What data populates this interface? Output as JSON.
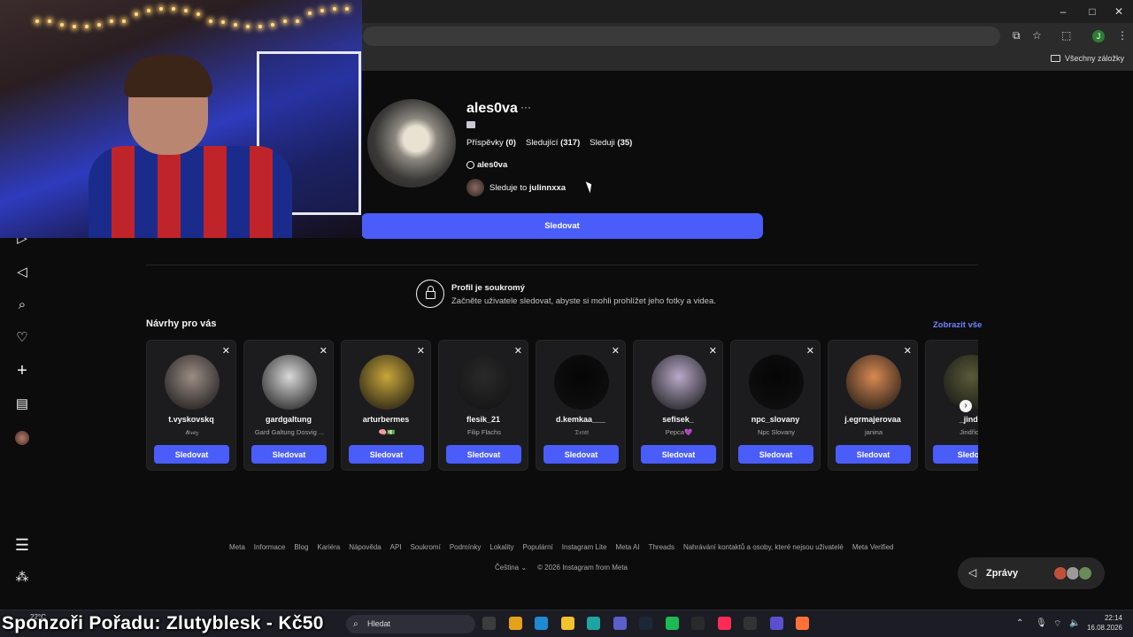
{
  "browser": {
    "window_controls": [
      "–",
      "□",
      "✕"
    ],
    "bookmarks_all_label": "Všechny záložky",
    "account_initial": "J"
  },
  "sidebar": {
    "icons": [
      "reels-icon",
      "send-icon",
      "search-icon",
      "heart-icon",
      "plus-icon",
      "insights-icon"
    ],
    "bottom_icons": [
      "menu-icon",
      "apps-icon"
    ]
  },
  "profile": {
    "username": "ales0va",
    "more_label": "···",
    "stats": {
      "posts_label": "Příspěvky",
      "posts_value": "(0)",
      "followers_label": "Sledující",
      "followers_value": "(317)",
      "following_label": "Sleduji",
      "following_value": "(35)"
    },
    "threads_handle": "ales0va",
    "followed_by_prefix": "Sleduje to",
    "followed_by_user": "julinnxxa",
    "follow_button": "Sledovat"
  },
  "private_notice": {
    "title": "Profil je soukromý",
    "description": "Začněte uživatele sledovat, abyste si mohli prohlížet jeho fotky a videa."
  },
  "suggestions": {
    "title": "Návrhy pro vás",
    "see_all": "Zobrazit vše",
    "items": [
      {
        "name": "t.vyskovskq",
        "sub": "𝓉𝑒𝓇𝑒𝓏",
        "button": "Sledovat",
        "color": "#9c8d85"
      },
      {
        "name": "gardgaltung",
        "sub": "Gard Galtung Dosvig ...",
        "button": "Sledovat",
        "color": "#d9d9d9"
      },
      {
        "name": "arturbermes",
        "sub": "🧠💵",
        "button": "Sledovat",
        "color": "#c9a63a"
      },
      {
        "name": "flesik_21",
        "sub": "Filip Flachs",
        "button": "Sledovat",
        "color": "#2a2a2a"
      },
      {
        "name": "d.kemkaa___",
        "sub": "𝔇𝔢𝔪𝔦",
        "button": "Sledovat",
        "color": "#050505"
      },
      {
        "name": "sefisek_",
        "sub": "Pepca💜",
        "button": "Sledovat",
        "color": "#b8a9c9"
      },
      {
        "name": "npc_slovany",
        "sub": "Npc Slovany",
        "button": "Sledovat",
        "color": "#050505"
      },
      {
        "name": "j.egrmajerovaa",
        "sub": "janina",
        "button": "Sledovat",
        "color": "#d98a52"
      },
      {
        "name": "_jindr",
        "sub": "Jindřich",
        "button": "Sledov",
        "color": "#5a5a3a"
      }
    ]
  },
  "footer": {
    "links": [
      "Meta",
      "Informace",
      "Blog",
      "Kariéra",
      "Nápověda",
      "API",
      "Soukromí",
      "Podmínky",
      "Lokality",
      "Populární",
      "Instagram Lite",
      "Meta AI",
      "Threads",
      "Nahrávání kontaktů a osoby, které nejsou uživatelé",
      "Meta Verified"
    ],
    "language": "Čeština ⌄",
    "copyright": "© 2026 Instagram from Meta"
  },
  "messages": {
    "label": "Zprávy",
    "avatar_colors": [
      "#c0503a",
      "#9a9a9a",
      "#6a8a5a"
    ]
  },
  "taskbar": {
    "weather": "22°C",
    "search_placeholder": "Hledat",
    "sponsor_overlay": "Sponzoři Pořadu: Zlutyblesk - Kč50",
    "time": "22:14",
    "date": "16.08.2026",
    "app_colors": [
      "#3c3c3c",
      "#e3a21a",
      "#1f8ad1",
      "#f2c12e",
      "#20a3a3",
      "#5b5fc7",
      "#1b2838",
      "#1db954",
      "#2a2a2a",
      "#fe2c55",
      "#333333",
      "#5a4fcf",
      "#ff7139"
    ]
  }
}
